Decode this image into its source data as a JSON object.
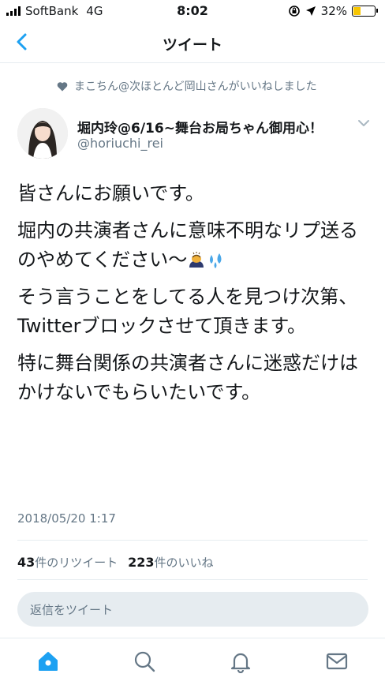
{
  "status_bar": {
    "carrier": "SoftBank",
    "network": "4G",
    "time": "8:02",
    "battery": "32%",
    "battery_level": 0.32,
    "battery_color": "#f7c500"
  },
  "nav": {
    "title": "ツイート",
    "back_icon": "chevron-left-icon"
  },
  "tweet": {
    "liked_by": "まこちん@次ほとんど岡山さんがいいねしました",
    "author_name": "堀内玲@6/16~舞台お局ちゃん御用心！",
    "author_handle": "@horiuchi_rei",
    "paragraphs": [
      "皆さんにお願いです。",
      "堀内の共演者さんに意味不明なリプ送るのやめてください〜",
      "そう言うことをしてる人を見つけ次第、Twitterブロックさせて頂きます。",
      "特に舞台関係の共演者さんに迷惑だけはかけないでもらいたいです。"
    ],
    "date": "2018/05/20 1:17",
    "retweet_count": "43",
    "retweet_label": "件のリツイート",
    "like_count": "223",
    "like_label": "件のいいね"
  },
  "reply": {
    "placeholder": "返信をツイート"
  },
  "tab_bar": {
    "items": [
      "home-icon",
      "search-icon",
      "notifications-icon",
      "messages-icon"
    ],
    "active": "home-icon"
  },
  "colors": {
    "accent": "#1da1f2",
    "secondary_text": "#657786",
    "divider": "#e6ecf0"
  }
}
